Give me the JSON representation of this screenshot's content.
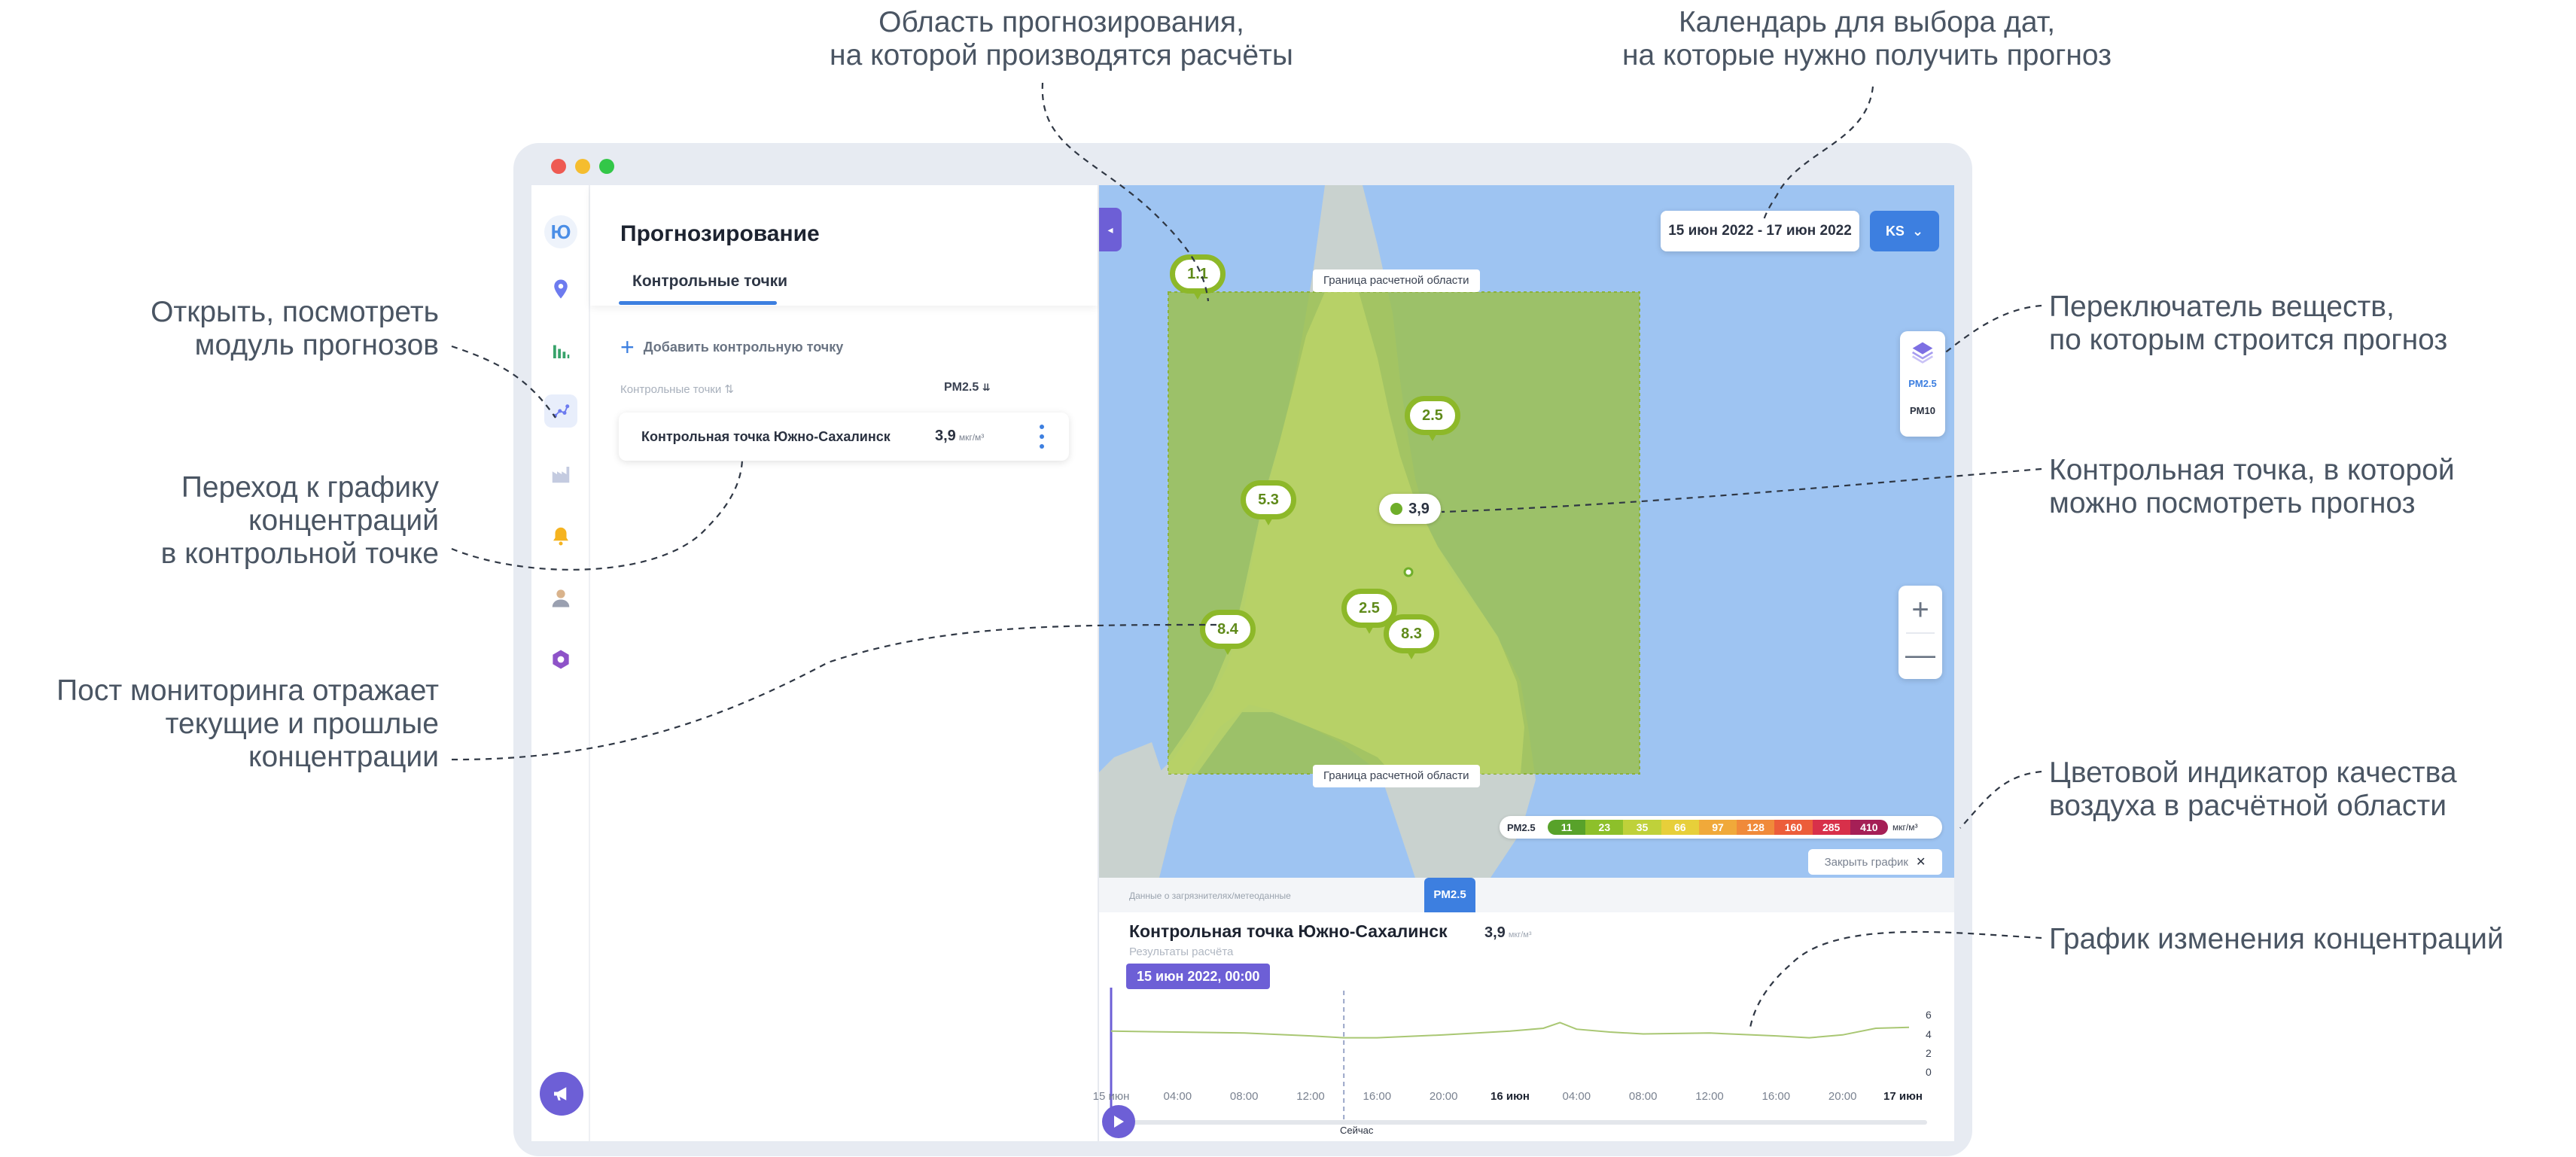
{
  "callouts": {
    "forecast_area": [
      "Область прогнозирования,",
      "на которой производятся расчёты"
    ],
    "calendar": [
      "Календарь для выбора дат,",
      "на которые нужно получить прогноз"
    ],
    "open_module": [
      "Открыть, посмотреть",
      "модуль прогнозов"
    ],
    "go_to_chart": [
      "Переход к графику",
      "концентраций",
      "в контрольной точке"
    ],
    "monitoring_post": [
      "Пост мониторинга отражает",
      "текущие и прошлые",
      "концентрации"
    ],
    "substance_switch": [
      "Переключатель веществ,",
      "по которым строится прогноз"
    ],
    "control_point": [
      "Контрольная точка, в которой",
      "можно посмотреть прогноз"
    ],
    "color_indicator": [
      "Цветовой индикатор качества",
      "воздуха в расчётной области"
    ],
    "chart": [
      "График изменения концентраций"
    ]
  },
  "window": {
    "traffic_lights": [
      "#ee5a52",
      "#f5bd2f",
      "#33c748"
    ]
  },
  "rail": {
    "logo": "Ю",
    "icons": [
      "map-pin-icon",
      "bar-chart-icon",
      "forecast-scatter-icon",
      "factory-icon",
      "bell-icon",
      "user-icon",
      "hexagon-icon",
      "megaphone-icon"
    ]
  },
  "panel": {
    "title": "Прогнозирование",
    "tab": "Контрольные точки",
    "add_point": "Добавить контрольную точку",
    "list_header_name": "Контрольные точки",
    "list_header_value": "PM2.5",
    "point": {
      "name": "Контрольная точка Южно-Сахалинск",
      "value": "3,9",
      "unit": "мкг/м³"
    }
  },
  "map": {
    "date_range": "15 июн 2022 - 17 июн 2022",
    "user_initials": "KS",
    "area_label_top": "Граница расчетной области",
    "area_label_bottom": "Граница расчетной области",
    "substances": [
      "PM2.5",
      "PM10"
    ],
    "active_substance": "PM2.5",
    "zoom_in": "+",
    "zoom_out": "—",
    "control_point_value": "3,9",
    "markers": [
      {
        "value": "1.1",
        "name": "monitoring-post-marker-1-1"
      },
      {
        "value": "2.5",
        "name": "monitoring-post-marker-2-5-north"
      },
      {
        "value": "5.3",
        "name": "monitoring-post-marker-5-3"
      },
      {
        "value": "2.5",
        "name": "monitoring-post-marker-2-5-south"
      },
      {
        "value": "8.4",
        "name": "monitoring-post-marker-8-4"
      },
      {
        "value": "8.3",
        "name": "monitoring-post-marker-8-3"
      }
    ],
    "legend": {
      "label": "PM2.5",
      "unit": "мкг/м³",
      "steps": [
        "11",
        "23",
        "35",
        "66",
        "97",
        "128",
        "160",
        "285",
        "410"
      ],
      "colors": [
        "#58a22a",
        "#8dc02a",
        "#bfd13a",
        "#e7cf3a",
        "#f0a93a",
        "#f08a3a",
        "#ec5d3a",
        "#d8304a",
        "#a51f56"
      ]
    },
    "close_chart": "Закрыть график",
    "colors": {
      "water": "#9ec4f2",
      "land": "#c9d2cf",
      "forecast_area": "#9bc14a",
      "accent": "#3d7fe0",
      "violet": "#6d5fd6"
    }
  },
  "chart_panel": {
    "source_label": "Данные о загрязнителях/метеоданные",
    "pm_tab": "PM2.5",
    "title": "Контрольная точка Южно-Сахалинск",
    "subtitle": "Результаты расчёта",
    "value": "3,9",
    "unit": "мкг/м³",
    "time_tag": "15 июн 2022, 00:00",
    "now_label": "Сейчас"
  },
  "chart_data": {
    "type": "line",
    "x_ticks": [
      "15 июн",
      "04:00",
      "08:00",
      "12:00",
      "16:00",
      "20:00",
      "16 июн",
      "04:00",
      "08:00",
      "12:00",
      "16:00",
      "20:00",
      "17 июн"
    ],
    "y_ticks": [
      0,
      2,
      4,
      6
    ],
    "ylim": [
      0,
      6.5
    ],
    "series": [
      {
        "hours": [
          0,
          4,
          8,
          12,
          14,
          16,
          20,
          24,
          26,
          27,
          28,
          30,
          32,
          36,
          40,
          42,
          44,
          46,
          48
        ],
        "values": [
          4.3,
          4.2,
          4.1,
          3.8,
          3.6,
          3.6,
          3.9,
          4.3,
          4.6,
          5.2,
          4.5,
          4.2,
          4.0,
          4.1,
          3.8,
          3.6,
          3.9,
          4.6,
          4.7
        ]
      }
    ],
    "now_hour": 14,
    "cursor_hour": 0,
    "grid": false
  }
}
